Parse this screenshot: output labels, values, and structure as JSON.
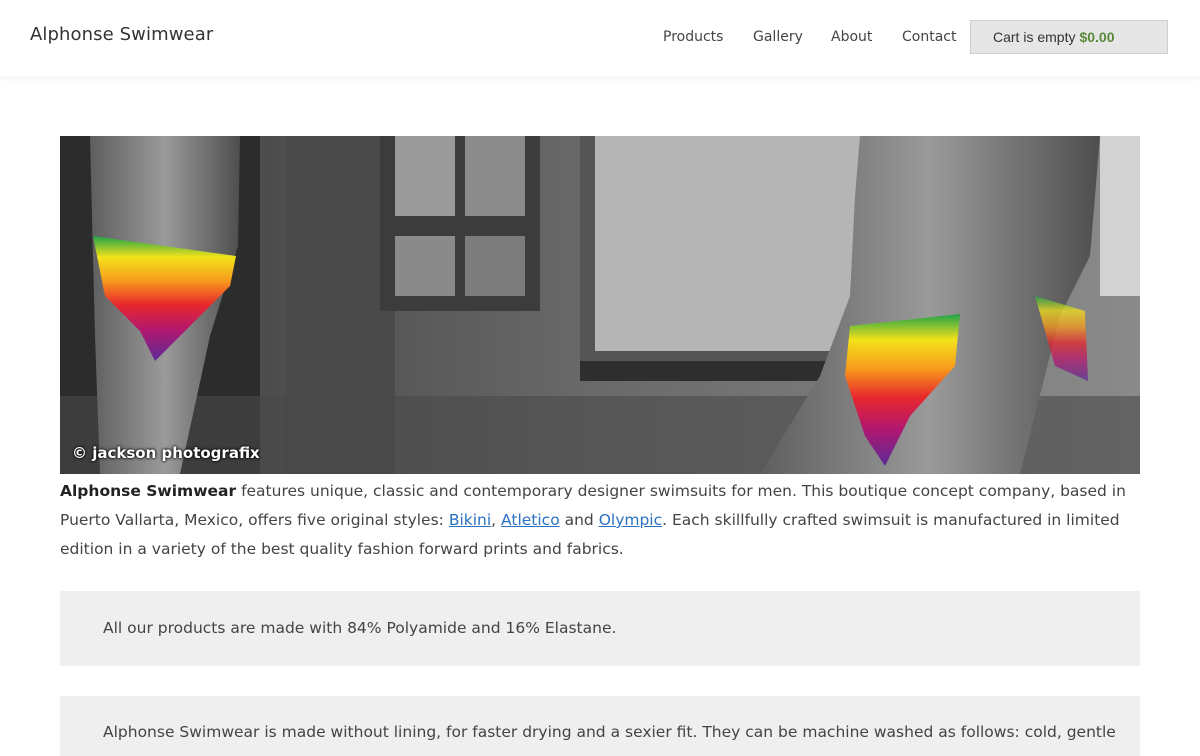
{
  "site": {
    "title": "Alphonse Swimwear"
  },
  "nav": {
    "items": [
      "Products",
      "Gallery",
      "About",
      "Contact"
    ]
  },
  "cart": {
    "label": "Cart is empty",
    "amount": "$0.00"
  },
  "hero": {
    "credit": "© jackson photografix"
  },
  "intro": {
    "brand": "Alphonse Swimwear",
    "text1": " features unique, classic and contemporary designer swimsuits for men. This boutique concept company, based in Puerto Vallarta, Mexico, offers five original styles: ",
    "link1": "Bikini",
    "sep1": ", ",
    "link2": "Atletico",
    "sep2": " and ",
    "link3": "Olympic",
    "text2": ". Each skillfully crafted swimsuit is manufactured in limited edition in a variety of the best quality fashion forward prints and fabrics."
  },
  "boxes": {
    "materials": "All our products are made with 84% Polyamide and 16% Elastane.",
    "care": "Alphonse Swimwear is made without lining, for faster drying and a sexier fit. They can be machine washed as follows: cold, gentle"
  },
  "colors": {
    "cart_amount": "#5b8a3a",
    "link": "#2a72c1",
    "box_bg": "#efefef"
  }
}
